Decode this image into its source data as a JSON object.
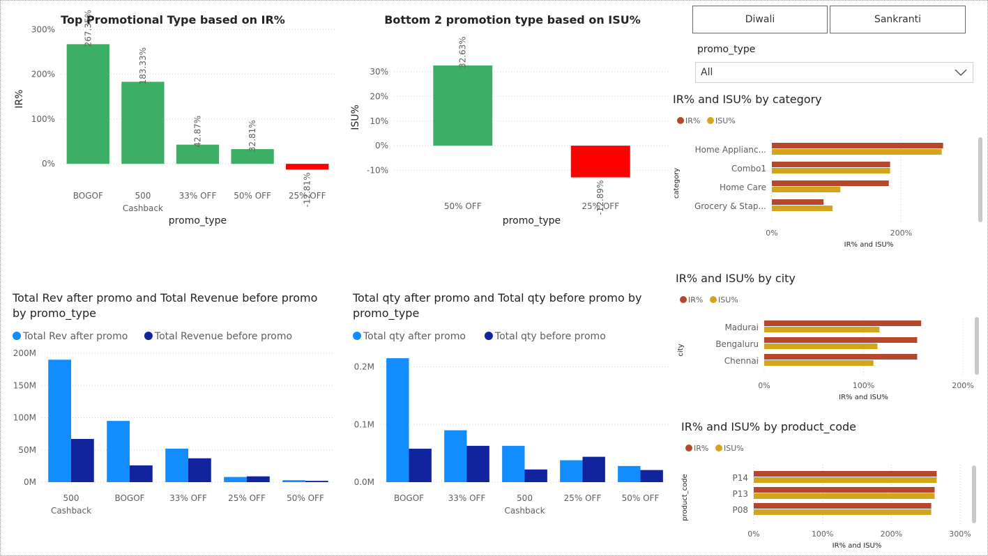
{
  "slicer": {
    "buttons": [
      "Diwali",
      "Sankranti"
    ],
    "promo_type_label": "promo_type",
    "promo_type_value": "All"
  },
  "colors": {
    "green": "#3DAE65",
    "red": "#FF0000",
    "blue_light": "#118DFF",
    "blue_dark": "#12239E",
    "ir": "#B7472A",
    "isu": "#D4A51C"
  },
  "chart_data": [
    {
      "id": "ir_by_promo",
      "type": "bar",
      "title": "Top Promotional Type based on IR%",
      "xlabel": "promo_type",
      "ylabel": "IR%",
      "categories": [
        "BOGOF",
        "500 Cashback",
        "33% OFF",
        "50% OFF",
        "25% OFF"
      ],
      "values": [
        267.35,
        183.33,
        42.87,
        32.81,
        -12.81
      ],
      "data_labels": [
        "267.35%",
        "183.33%",
        "42.87%",
        "32.81%",
        "-12.81%"
      ],
      "ylim": [
        -20,
        310
      ],
      "yticks": [
        0,
        100,
        200,
        300
      ],
      "ytick_labels": [
        "0%",
        "100%",
        "200%",
        "300%"
      ],
      "grid": true
    },
    {
      "id": "isu_bottom2",
      "type": "bar",
      "title": "Bottom 2 promotion type based on ISU%",
      "xlabel": "promo_type",
      "ylabel": "ISU%",
      "categories": [
        "50% OFF",
        "25% OFF"
      ],
      "values": [
        32.63,
        -12.89
      ],
      "data_labels": [
        "32.63%",
        "-12.89%"
      ],
      "ylim": [
        -15,
        38
      ],
      "yticks": [
        -10,
        0,
        10,
        20,
        30
      ],
      "ytick_labels": [
        "-10%",
        "0%",
        "10%",
        "20%",
        "30%"
      ],
      "grid": true
    },
    {
      "id": "rev_by_promo",
      "type": "bar",
      "title": "Total Rev after promo and Total Revenue before promo by promo_type",
      "title_lines": [
        "Total Rev after promo and Total Revenue before promo",
        "by promo_type"
      ],
      "categories": [
        "500 Cashback",
        "BOGOF",
        "33% OFF",
        "25% OFF",
        "50% OFF"
      ],
      "series": [
        {
          "name": "Total Rev after promo",
          "values": [
            190,
            95,
            52,
            8,
            3
          ]
        },
        {
          "name": "Total Revenue before promo",
          "values": [
            67,
            26,
            37,
            9,
            2
          ]
        }
      ],
      "ylim": [
        0,
        200
      ],
      "yticks": [
        0,
        50,
        100,
        150,
        200
      ],
      "ytick_labels": [
        "0M",
        "50M",
        "100M",
        "150M",
        "200M"
      ],
      "legend": "top-left",
      "grid": true
    },
    {
      "id": "qty_by_promo",
      "type": "bar",
      "title": "Total qty after promo and Total qty before promo by promo_type",
      "title_lines": [
        "Total qty after promo and Total qty before promo by",
        "promo_type"
      ],
      "categories": [
        "BOGOF",
        "33% OFF",
        "500 Cashback",
        "25% OFF",
        "50% OFF"
      ],
      "series": [
        {
          "name": "Total qty after promo",
          "values": [
            0.215,
            0.09,
            0.063,
            0.038,
            0.028
          ]
        },
        {
          "name": "Total qty before promo",
          "values": [
            0.058,
            0.063,
            0.022,
            0.044,
            0.021
          ]
        }
      ],
      "ylim": [
        0,
        0.22
      ],
      "yticks": [
        0,
        0.1,
        0.2
      ],
      "ytick_labels": [
        "0.0M",
        "0.1M",
        "0.2M"
      ],
      "legend": "top-left",
      "grid": true
    },
    {
      "id": "by_category",
      "type": "bar",
      "orientation": "horizontal",
      "title": "IR% and ISU% by category",
      "xlabel": "IR% and ISU%",
      "ylabel": "category",
      "categories": [
        "Home Applianc...",
        "Combo1",
        "Home Care",
        "Grocery & Stap..."
      ],
      "series": [
        {
          "name": "IR%",
          "values": [
            265,
            183,
            181,
            80
          ]
        },
        {
          "name": "ISU%",
          "values": [
            263,
            183,
            106,
            94
          ]
        }
      ],
      "xlim": [
        0,
        300
      ],
      "xticks": [
        0,
        200
      ],
      "xtick_labels": [
        "0%",
        "200%"
      ],
      "legend": "top-left",
      "grid": true
    },
    {
      "id": "by_city",
      "type": "bar",
      "orientation": "horizontal",
      "title": "IR% and ISU% by city",
      "xlabel": "IR% and ISU%",
      "ylabel": "city",
      "categories": [
        "Madurai",
        "Bengaluru",
        "Chennai"
      ],
      "series": [
        {
          "name": "IR%",
          "values": [
            158,
            154,
            154
          ]
        },
        {
          "name": "ISU%",
          "values": [
            116,
            114,
            110
          ]
        }
      ],
      "xlim": [
        0,
        200
      ],
      "xticks": [
        0,
        100,
        200
      ],
      "xtick_labels": [
        "0%",
        "100%",
        "200%"
      ],
      "legend": "top-left",
      "grid": true
    },
    {
      "id": "by_product",
      "type": "bar",
      "orientation": "horizontal",
      "title": "IR% and ISU% by product_code",
      "xlabel": "IR% and ISU%",
      "ylabel": "product_code",
      "categories": [
        "P14",
        "P13",
        "P08"
      ],
      "series": [
        {
          "name": "IR%",
          "values": [
            266,
            263,
            258
          ]
        },
        {
          "name": "ISU%",
          "values": [
            266,
            263,
            258
          ]
        }
      ],
      "xlim": [
        0,
        300
      ],
      "xticks": [
        0,
        100,
        200,
        300
      ],
      "xtick_labels": [
        "0%",
        "100%",
        "200%",
        "300%"
      ],
      "legend": "top-left",
      "grid": true
    }
  ]
}
